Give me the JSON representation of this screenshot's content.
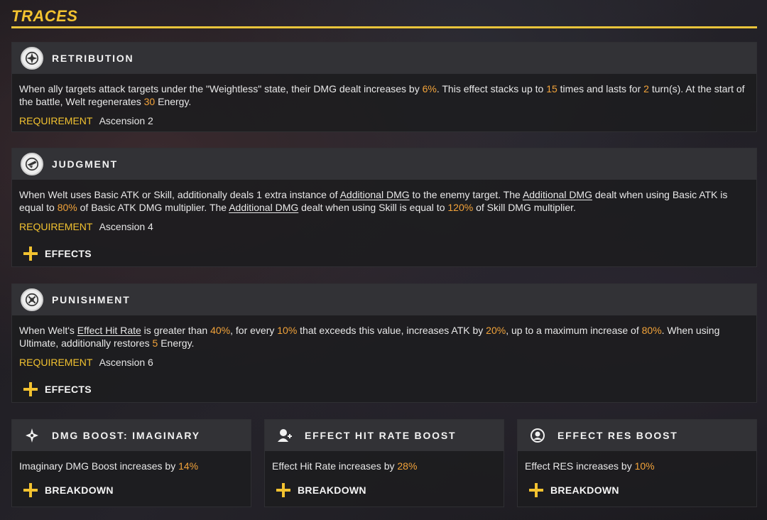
{
  "section": {
    "title": "TRACES"
  },
  "requirement_label": "REQUIREMENT",
  "traces": [
    {
      "icon": "retribution-icon",
      "name": "RETRIBUTION",
      "desc": [
        {
          "t": "When ally targets attack targets under the \"Weightless\" state, their DMG dealt increases by "
        },
        {
          "t": "6%",
          "s": "hl"
        },
        {
          "t": ". This effect stacks up to "
        },
        {
          "t": "15",
          "s": "hl"
        },
        {
          "t": " times and lasts for "
        },
        {
          "t": "2",
          "s": "hl"
        },
        {
          "t": " turn(s). At the start of the battle, Welt regenerates "
        },
        {
          "t": "30",
          "s": "hl"
        },
        {
          "t": " Energy."
        }
      ],
      "requirement": "Ascension 2"
    },
    {
      "icon": "judgment-icon",
      "name": "JUDGMENT",
      "desc": [
        {
          "t": "When Welt uses Basic ATK or Skill, additionally deals 1 extra instance of "
        },
        {
          "t": "Additional DMG",
          "s": "ul"
        },
        {
          "t": " to the enemy target. The "
        },
        {
          "t": "Additional DMG",
          "s": "ul"
        },
        {
          "t": " dealt when using Basic ATK is equal to "
        },
        {
          "t": "80%",
          "s": "hl"
        },
        {
          "t": " of Basic ATK DMG multiplier. The "
        },
        {
          "t": "Additional DMG",
          "s": "ul"
        },
        {
          "t": " dealt when using Skill is equal to "
        },
        {
          "t": "120%",
          "s": "hl"
        },
        {
          "t": " of Skill DMG multiplier."
        }
      ],
      "requirement": "Ascension 4",
      "effects_label": "EFFECTS"
    },
    {
      "icon": "punishment-icon",
      "name": "PUNISHMENT",
      "desc": [
        {
          "t": "When Welt's "
        },
        {
          "t": "Effect Hit Rate",
          "s": "ul"
        },
        {
          "t": " is greater than "
        },
        {
          "t": "40%",
          "s": "hl"
        },
        {
          "t": ", for every "
        },
        {
          "t": "10%",
          "s": "hl"
        },
        {
          "t": " that exceeds this value, increases ATK by "
        },
        {
          "t": "20%",
          "s": "hl"
        },
        {
          "t": ", up to a maximum increase of "
        },
        {
          "t": "80%",
          "s": "hl"
        },
        {
          "t": ". When using Ultimate, additionally restores "
        },
        {
          "t": "5",
          "s": "hl"
        },
        {
          "t": " Energy."
        }
      ],
      "requirement": "Ascension 6",
      "effects_label": "EFFECTS"
    }
  ],
  "stat_boosts": [
    {
      "icon": "imaginary-icon",
      "name": "DMG BOOST: IMAGINARY",
      "text": "Imaginary DMG Boost increases by ",
      "value": "14%",
      "button": "BREAKDOWN"
    },
    {
      "icon": "effect-hit-rate-icon",
      "name": "EFFECT HIT RATE BOOST",
      "text": "Effect Hit Rate increases by ",
      "value": "28%",
      "button": "BREAKDOWN"
    },
    {
      "icon": "effect-res-icon",
      "name": "EFFECT RES BOOST",
      "text": "Effect RES increases by ",
      "value": "10%",
      "button": "BREAKDOWN"
    }
  ],
  "colors": {
    "accent": "#f2c230",
    "highlight": "#f2a33a"
  }
}
